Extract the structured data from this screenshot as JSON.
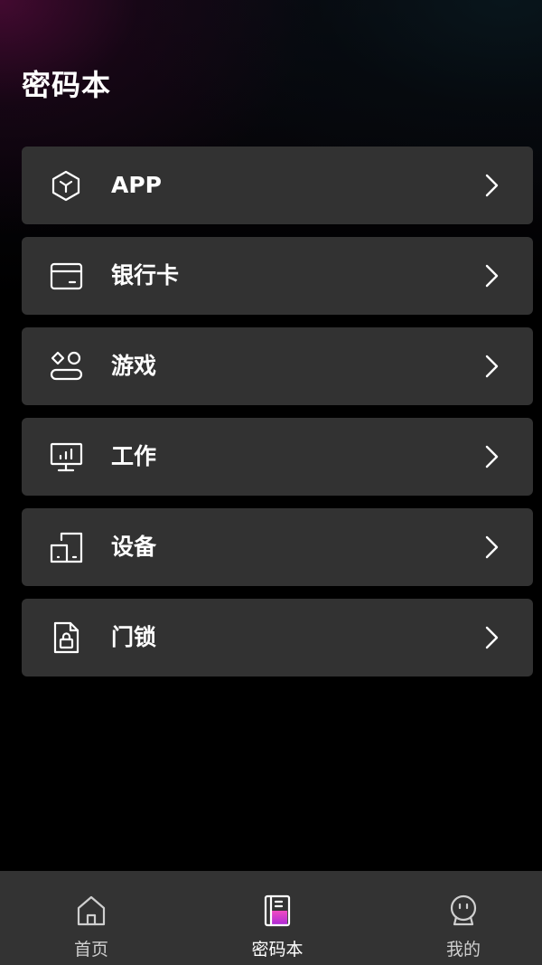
{
  "page": {
    "title": "密码本"
  },
  "categories": [
    {
      "label": "APP",
      "icon": "cube-icon"
    },
    {
      "label": "银行卡",
      "icon": "card-icon"
    },
    {
      "label": "游戏",
      "icon": "game-icon"
    },
    {
      "label": "工作",
      "icon": "presentation-chart-icon"
    },
    {
      "label": "设备",
      "icon": "devices-icon"
    },
    {
      "label": "门锁",
      "icon": "lock-file-icon"
    }
  ],
  "tabbar": {
    "tabs": [
      {
        "label": "首页",
        "icon": "home-icon",
        "active": false
      },
      {
        "label": "密码本",
        "icon": "notebook-icon",
        "active": true
      },
      {
        "label": "我的",
        "icon": "profile-face-icon",
        "active": false
      }
    ]
  },
  "colors": {
    "background": "#000000",
    "card": "#323232",
    "tabbar": "#333333",
    "accent": "#e23bb0",
    "text": "#ffffff"
  }
}
